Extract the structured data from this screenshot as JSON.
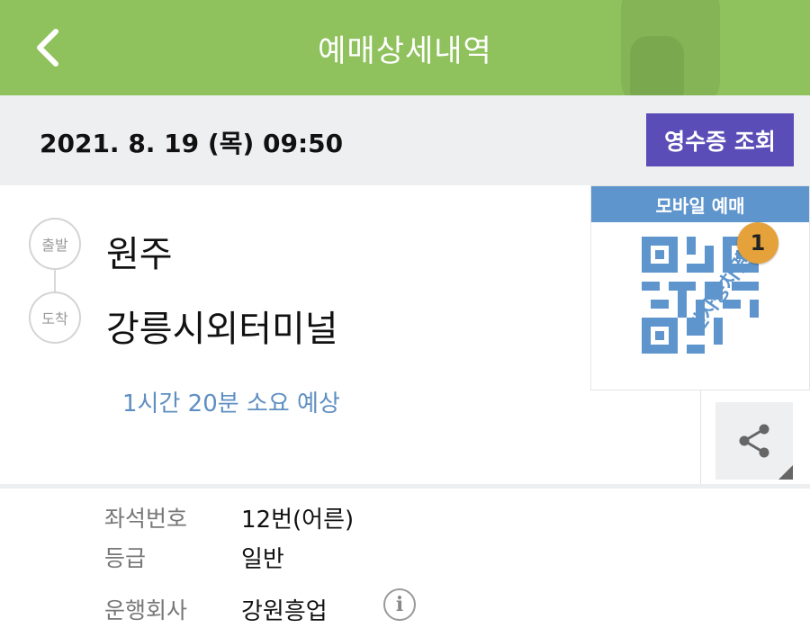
{
  "header": {
    "title": "예매상세내역",
    "back_icon": "chevron-left-icon",
    "color": "#8fc25d"
  },
  "datebar": {
    "datetime": "2021. 8. 19 (목) 09:50",
    "receipt_button": "영수증 조회",
    "receipt_color": "#5a4db7"
  },
  "route": {
    "departure_label": "출발",
    "departure_name": "원주",
    "arrival_label": "도착",
    "arrival_name": "강릉시외터미널",
    "duration": "1시간 20분 소요 예상"
  },
  "ticket": {
    "title": "모바일 예매",
    "count": "1",
    "stamp": "전자승차권",
    "accent": "#5f95cd"
  },
  "share": {
    "icon": "share-icon"
  },
  "details": {
    "rows": [
      {
        "label": "좌석번호",
        "value": "12번(어른)"
      },
      {
        "label": "등급",
        "value": "일반"
      },
      {
        "label": "운행회사",
        "value": "강원흥업"
      }
    ],
    "info_icon": "info-icon"
  }
}
